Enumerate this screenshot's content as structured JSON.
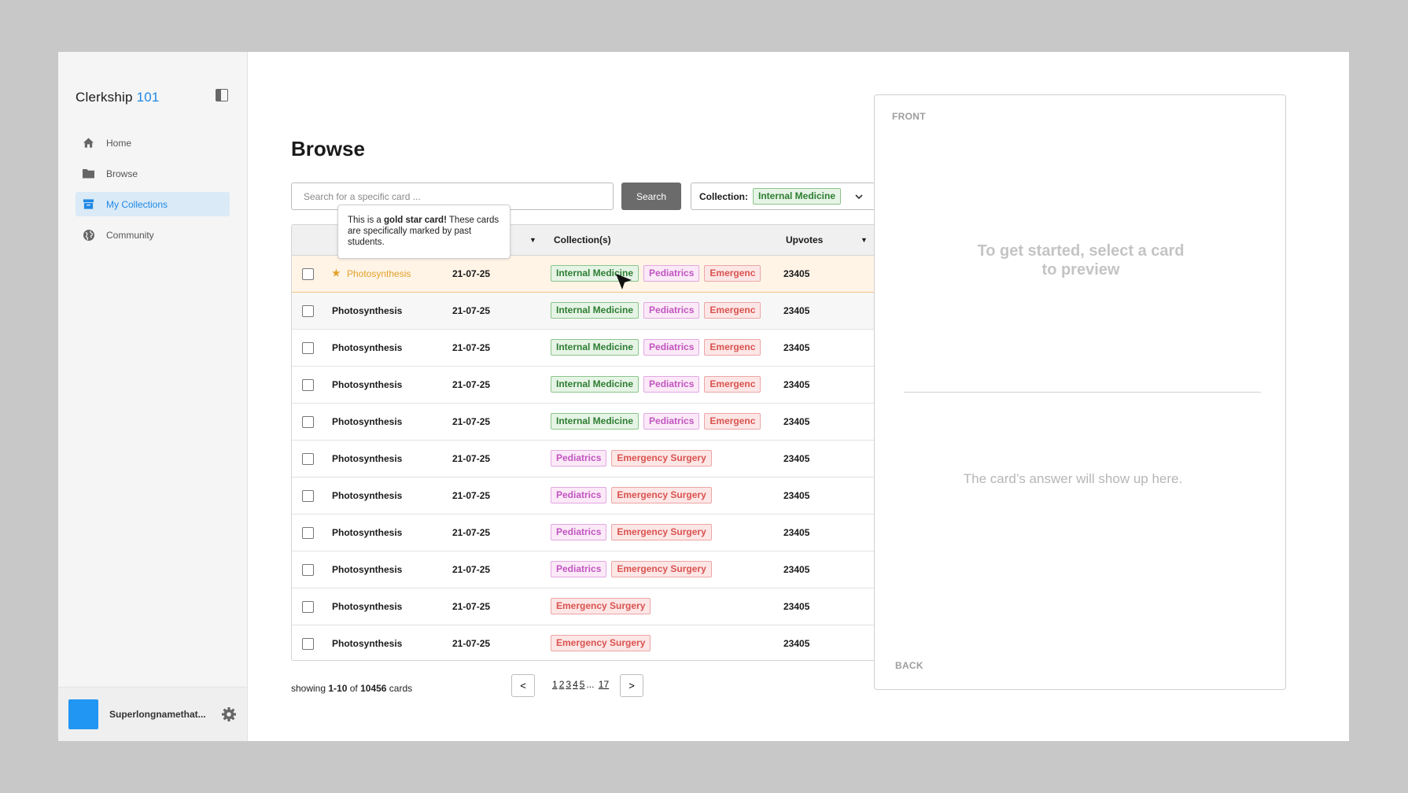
{
  "colors": {
    "accent": "#1e88e5",
    "gold": "#e2a12a",
    "search_button": "#6b6b6b",
    "avatar": "#2196f3"
  },
  "sidebar": {
    "brand_name": "Clerkship",
    "brand_number": "101",
    "items": [
      {
        "label": "Home",
        "icon": "home-icon"
      },
      {
        "label": "Browse",
        "icon": "folder-icon"
      },
      {
        "label": "My Collections",
        "icon": "collection-icon",
        "active": true
      },
      {
        "label": "Community",
        "icon": "globe-icon"
      }
    ],
    "username": "Superlongnamethat..."
  },
  "main": {
    "title": "Browse",
    "search": {
      "placeholder": "Search for a specific card ...",
      "button_label": "Search"
    },
    "collection_filter": {
      "label": "Collection:",
      "value": "Internal Medicine"
    },
    "tooltip": {
      "prefix": "This is a ",
      "bold": "gold star card!",
      "suffix": " These cards are specifically marked by past students."
    },
    "table": {
      "headers": {
        "collections": "Collection(s)",
        "upvotes": "Upvotes"
      },
      "tag_labels": {
        "im": "Internal Medicine",
        "ped": "Pediatrics",
        "es": "Emergency Surgery",
        "es_short": "Emergenc"
      },
      "rows": [
        {
          "name": "Photosynthesis",
          "date": "21-07-25",
          "upvotes": "23405",
          "gold": true
        },
        {
          "name": "Photosynthesis",
          "date": "21-07-25",
          "upvotes": "23405"
        },
        {
          "name": "Photosynthesis",
          "date": "21-07-25",
          "upvotes": "23405"
        },
        {
          "name": "Photosynthesis",
          "date": "21-07-25",
          "upvotes": "23405"
        },
        {
          "name": "Photosynthesis",
          "date": "21-07-25",
          "upvotes": "23405"
        },
        {
          "name": "Photosynthesis",
          "date": "21-07-25",
          "upvotes": "23405"
        },
        {
          "name": "Photosynthesis",
          "date": "21-07-25",
          "upvotes": "23405"
        },
        {
          "name": "Photosynthesis",
          "date": "21-07-25",
          "upvotes": "23405"
        },
        {
          "name": "Photosynthesis",
          "date": "21-07-25",
          "upvotes": "23405"
        },
        {
          "name": "Photosynthesis",
          "date": "21-07-25",
          "upvotes": "23405"
        },
        {
          "name": "Photosynthesis",
          "date": "21-07-25",
          "upvotes": "23405"
        }
      ]
    },
    "pagination": {
      "showing_prefix": "showing ",
      "range": "1-10",
      "of": " of ",
      "total": "10456",
      "suffix": " cards",
      "prev": "<",
      "next": ">",
      "pages": [
        "1",
        "2",
        "3",
        "4",
        "5"
      ],
      "ellipsis": "...",
      "last": "17"
    }
  },
  "preview": {
    "front_label": "FRONT",
    "start_line1": "To get started, select a card",
    "start_line2": "to preview",
    "answer_message": "The card’s answer will show up here.",
    "back_label": "BACK"
  }
}
